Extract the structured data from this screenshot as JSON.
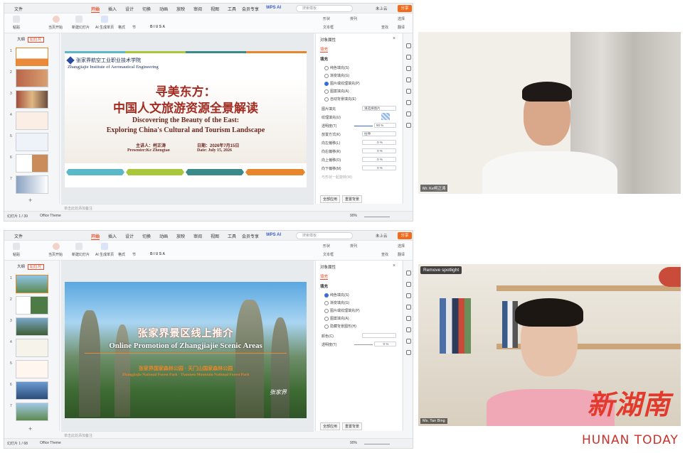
{
  "colors": {
    "accent": "#e84a27",
    "wps_blue": "#3b5ccc",
    "share": "#f26b1d",
    "brand_red": "#c9322a"
  },
  "menu": {
    "items": [
      "文件",
      "开始",
      "插入",
      "设计",
      "切换",
      "动画",
      "放映",
      "审阅",
      "视图",
      "工具",
      "会员专享"
    ],
    "active_index": 1,
    "wps_ai": "WPS AI",
    "search_placeholder": "搜索模板",
    "cloud": "未上云",
    "share": "分享"
  },
  "ribbon": {
    "paste": "粘贴",
    "from_current": "当页开始",
    "new_slide": "新建幻灯片",
    "ai_gen": "AI 生成单页",
    "format": "格式",
    "section": "节",
    "shape": "形状",
    "arrange": "排列",
    "textbox": "文本框",
    "find": "查找",
    "select": "选择",
    "translate": "翻译"
  },
  "left_panel": {
    "tab_outline": "大纲",
    "tab_slides": "幻灯片",
    "slides_count": "1 / 39"
  },
  "window1": {
    "slide": {
      "school_cn": "张家界航空工业职业技术学院",
      "school_en": "Zhangjiajie Institute of Aeronautical Engineering",
      "title_cn_1": "寻美东方：",
      "title_cn_2": "中国人文旅游资源全景解读",
      "title_en_1": "Discovering the Beauty of the East:",
      "title_en_2": "Exploring China's Cultural and Tourism Landscape",
      "speaker_cn": "主讲人：柯正涛",
      "date_cn": "日期：2026年7月15日",
      "speaker_en": "Presenter:Ke Zhengtao",
      "date_en": "Date: July 15, 2026"
    },
    "status": {
      "slide": "幻灯片 1 / 39",
      "theme": "Office Theme",
      "zoom": "90%"
    },
    "notes_placeholder": "单击此处添加备注"
  },
  "window2": {
    "slide": {
      "title_cn": "张家界景区线上推介",
      "title_en": "Online Promotion of Zhangjiajie Scenic Areas",
      "subtitle_cn": "张家界国家森林公园 · 天门山国家森林公园",
      "subtitle_en": "Zhangjiajie National Forest Park · Tianmen Mountain National Forest Park",
      "logo": "张家界"
    },
    "status": {
      "slide": "幻灯片 1 / 68",
      "theme": "Office Theme",
      "zoom": "90%"
    },
    "notes_placeholder": "单击此处添加备注"
  },
  "panel1": {
    "title": "对象属性",
    "tab": "填充",
    "section": "填充",
    "options": [
      "纯色填充(S)",
      "渐变填充(G)",
      "图片或纹理填充(P)",
      "图案填充(A)",
      "自动背景填充(E)"
    ],
    "selected_option": 2,
    "fields": [
      {
        "label": "图片填充",
        "value": "请选择图片"
      },
      {
        "label": "纹理填充(U)",
        "value": ""
      },
      {
        "label": "透明度(T)",
        "value": "90 %"
      },
      {
        "label": "放置方式(K)",
        "value": "拉伸"
      },
      {
        "label": "向左偏移(L)",
        "value": "0 %"
      },
      {
        "label": "向右偏移(R)",
        "value": "0 %"
      },
      {
        "label": "向上偏移(O)",
        "value": "0 %"
      },
      {
        "label": "向下偏移(M)",
        "value": "0 %"
      }
    ],
    "tile_checkbox": "与形状一起旋转(W)",
    "buttons": [
      "全部应用",
      "重置背景"
    ]
  },
  "panel2": {
    "title": "对象属性",
    "tab": "填充",
    "section": "填充",
    "options": [
      "纯色填充(S)",
      "渐变填充(G)",
      "图片或纹理填充(P)",
      "图案填充(A)",
      "隐藏背景图形(H)"
    ],
    "selected_option": 0,
    "fields": [
      {
        "label": "颜色(C)",
        "value": ""
      },
      {
        "label": "透明度(T)",
        "value": "0 %"
      }
    ],
    "buttons": [
      "全部应用",
      "重置背景"
    ]
  },
  "video1": {
    "label": "Mr. Ke柯正涛"
  },
  "video2": {
    "label": "Ms. Tan Bing",
    "spotlight": "Remove spotlight"
  },
  "watermark": {
    "cn": "新湖南",
    "en": "HUNAN TODAY"
  }
}
